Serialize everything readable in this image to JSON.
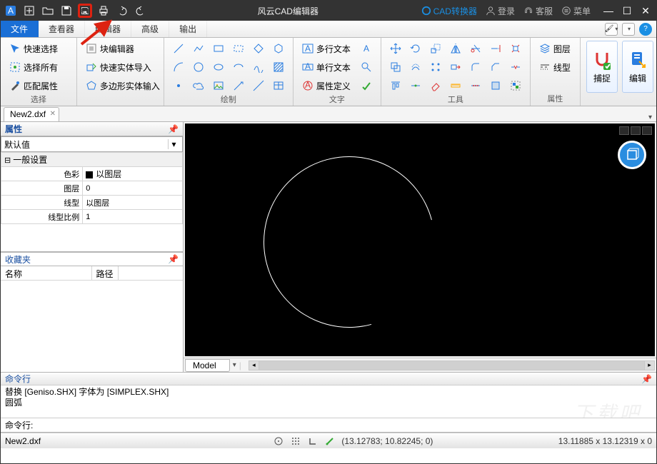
{
  "app": {
    "title": "风云CAD编辑器"
  },
  "titlebar_links": {
    "converter": "CAD转换器",
    "login": "登录",
    "support": "客服",
    "menu": "菜单"
  },
  "menu": {
    "file": "文件",
    "viewer": "查看器",
    "editor": "编辑器",
    "advanced": "高级",
    "output": "输出"
  },
  "ribbon": {
    "select": {
      "label": "选择",
      "quick": "快速选择",
      "all": "选择所有",
      "match": "匹配属性"
    },
    "block": {
      "label": "",
      "edit": "块编辑器",
      "import": "快速实体导入",
      "polytext": "多边形实体输入"
    },
    "draw": {
      "label": "绘制"
    },
    "text": {
      "label": "文字",
      "mtext": "多行文本",
      "stext": "单行文本",
      "attr": "属性定义"
    },
    "tools": {
      "label": "工具"
    },
    "layer": {
      "label": "属性",
      "layers": "图层",
      "linetype": "线型"
    },
    "snap": "捕捉",
    "edit": "编辑"
  },
  "doc": {
    "tab": "New2.dxf"
  },
  "props": {
    "title": "属性",
    "combo": "默认值",
    "group_general": "一般设置",
    "rows": {
      "color_k": "色彩",
      "color_v": "以图层",
      "layer_k": "图层",
      "layer_v": "0",
      "lt_k": "线型",
      "lt_v": "以图层",
      "lts_k": "线型比例",
      "lts_v": "1"
    }
  },
  "fav": {
    "title": "收藏夹",
    "col_name": "名称",
    "col_path": "路径"
  },
  "model": {
    "tab": "Model"
  },
  "cmd": {
    "title": "命令行",
    "log1": "替换 [Geniso.SHX] 字体为 [SIMPLEX.SHX]",
    "log2": "圆弧",
    "prompt": "命令行:"
  },
  "status": {
    "file": "New2.dxf",
    "cursor": "(13.12783; 10.82245; 0)",
    "extents": "13.11885 x 13.12319 x 0"
  }
}
